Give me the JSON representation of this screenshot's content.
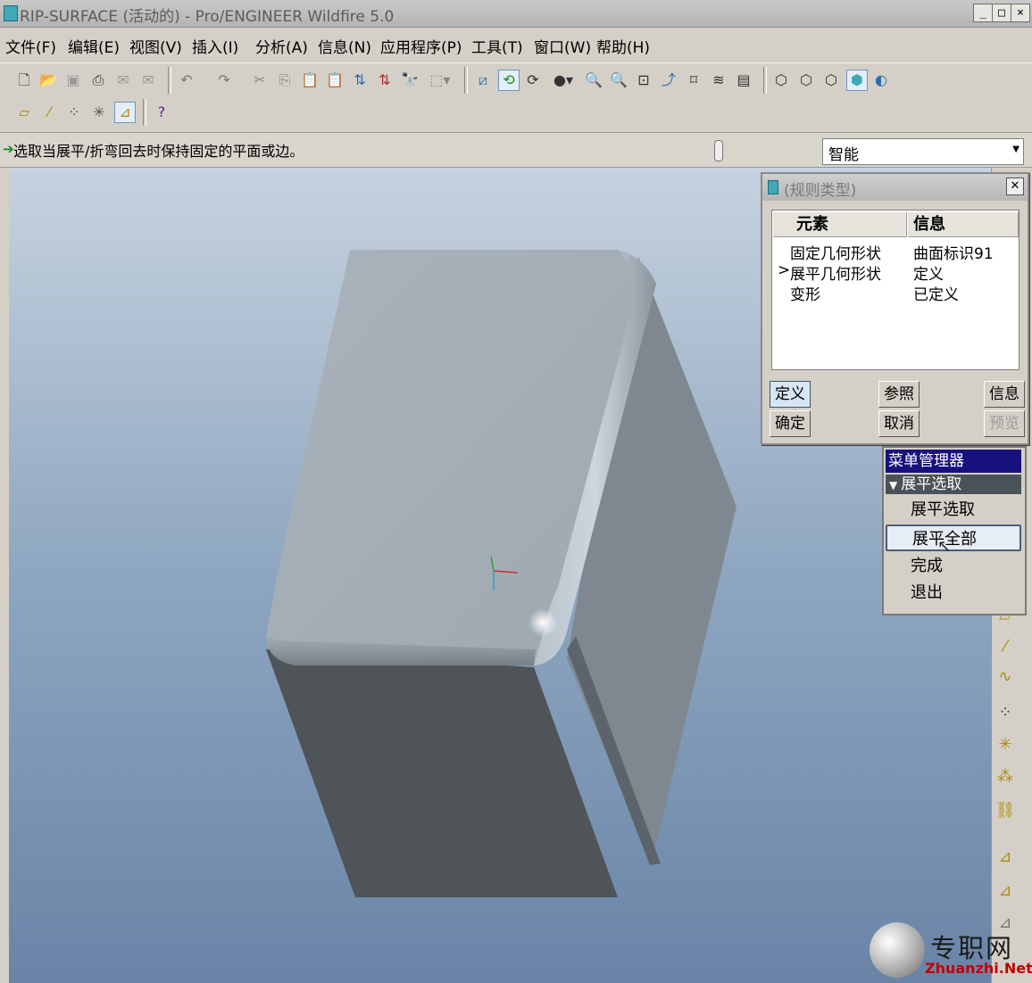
{
  "window": {
    "title": "RIP-SURFACE (活动的) - Pro/ENGINEER Wildfire 5.0",
    "controls": [
      "_",
      "□",
      "×"
    ]
  },
  "menubar": [
    "文件(F)",
    "编辑(E)",
    "视图(V)",
    "插入(I)",
    "分析(A)",
    "信息(N)",
    "应用程序(P)",
    "工具(T)",
    "窗口(W)",
    "帮助(H)"
  ],
  "message": {
    "text": "选取当展平/折弯回去时保持固定的平面或边。"
  },
  "filter": {
    "value": "智能"
  },
  "dialog": {
    "title": "(规则类型)",
    "columns": [
      "元素",
      "信息"
    ],
    "rows": [
      {
        "marker": "",
        "element": "固定几何形状",
        "info": "曲面标识91"
      },
      {
        "marker": ">",
        "element": "展平几何形状",
        "info": "定义"
      },
      {
        "marker": "",
        "element": "变形",
        "info": "已定义"
      }
    ],
    "buttons": {
      "define": "定义",
      "refs": "参照",
      "info": "信息",
      "ok": "确定",
      "cancel": "取消",
      "preview": "预览"
    }
  },
  "menu_manager": {
    "title": "菜单管理器",
    "section": "展平选取",
    "items": [
      "展平选取",
      "展平全部",
      "完成",
      "退出"
    ],
    "highlighted": "展平全部"
  },
  "watermark": {
    "cn": "专职网",
    "en": "Zhuanzhi.Net"
  },
  "colors": {
    "menu_title_bg": "#17117e",
    "section_bg": "#4a5358",
    "viewport_top": "#c6d2df",
    "viewport_bottom": "#6984a7"
  }
}
